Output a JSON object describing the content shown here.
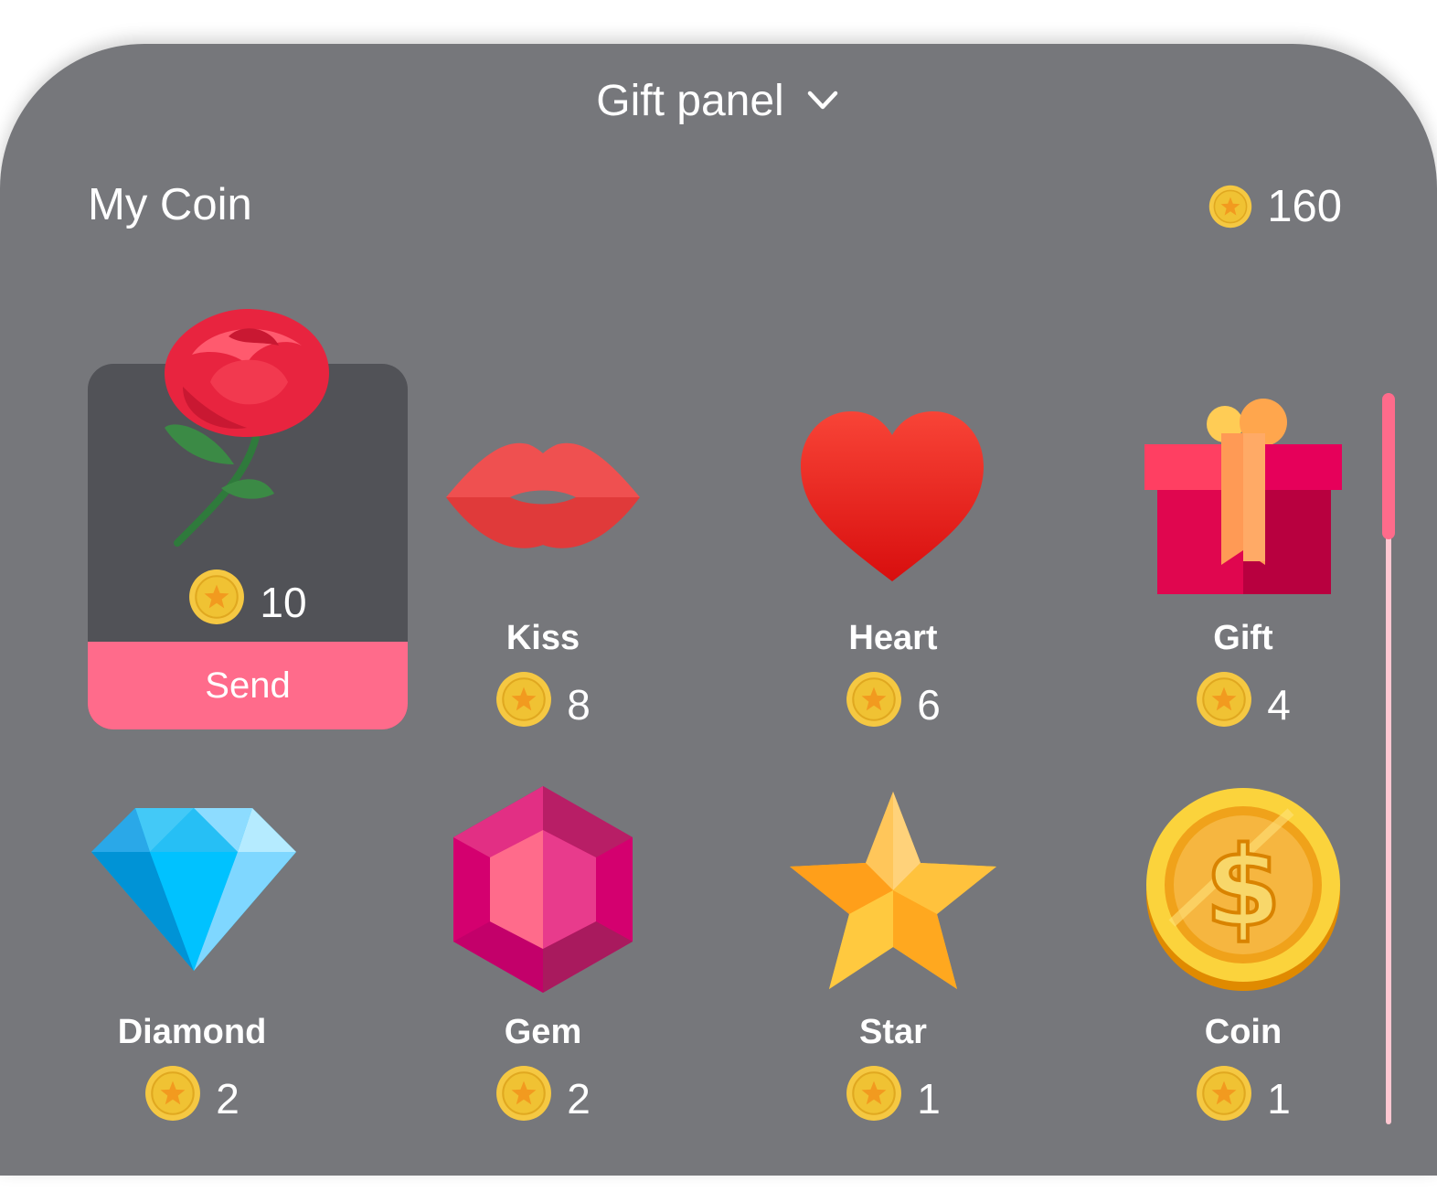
{
  "header": {
    "title": "Gift panel",
    "dropdown_icon": "chevron-down-icon"
  },
  "wallet": {
    "label": "My Coin",
    "balance": "160",
    "coin_icon": "coin-star-icon"
  },
  "selected_gift": {
    "name": "Rose",
    "price": "10",
    "send_label": "Send"
  },
  "gifts": [
    {
      "name": "Kiss",
      "price": "8",
      "icon": "lips-icon"
    },
    {
      "name": "Heart",
      "price": "6",
      "icon": "heart-icon"
    },
    {
      "name": "Gift",
      "price": "4",
      "icon": "gift-box-icon"
    },
    {
      "name": "Diamond",
      "price": "2",
      "icon": "diamond-icon"
    },
    {
      "name": "Gem",
      "price": "2",
      "icon": "gem-icon"
    },
    {
      "name": "Star",
      "price": "1",
      "icon": "star-icon"
    },
    {
      "name": "Coin",
      "price": "1",
      "icon": "dollar-coin-icon"
    }
  ],
  "colors": {
    "panel": "#76777b",
    "card": "#515257",
    "accent": "#ff6b8b",
    "coin": "#f5c842"
  }
}
